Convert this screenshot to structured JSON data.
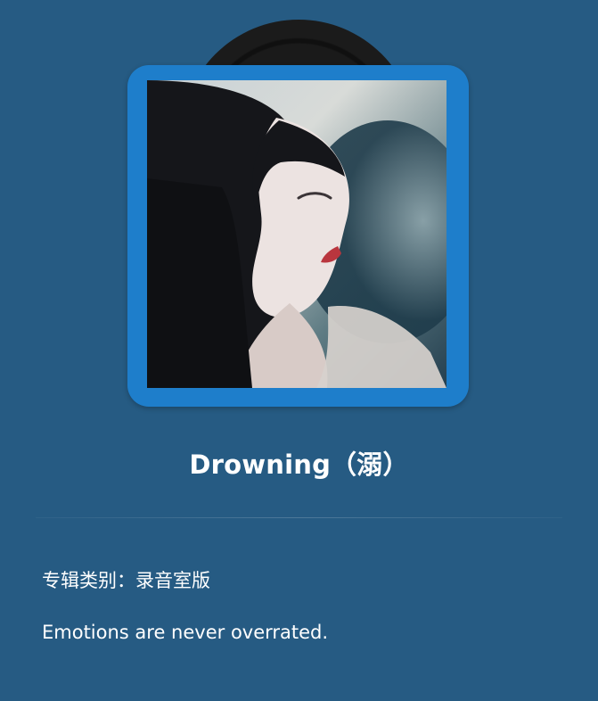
{
  "album": {
    "image_alt": "Album cover with portrait of a woman with dark hair"
  },
  "song": {
    "title": "Drowning（溺）"
  },
  "details": {
    "category_label": "专辑类别：",
    "category_value": "录音室版",
    "description": "Emotions are never overrated."
  },
  "colors": {
    "background": "#265b83",
    "frame": "#1e7ecb",
    "vinyl": "#141414"
  }
}
